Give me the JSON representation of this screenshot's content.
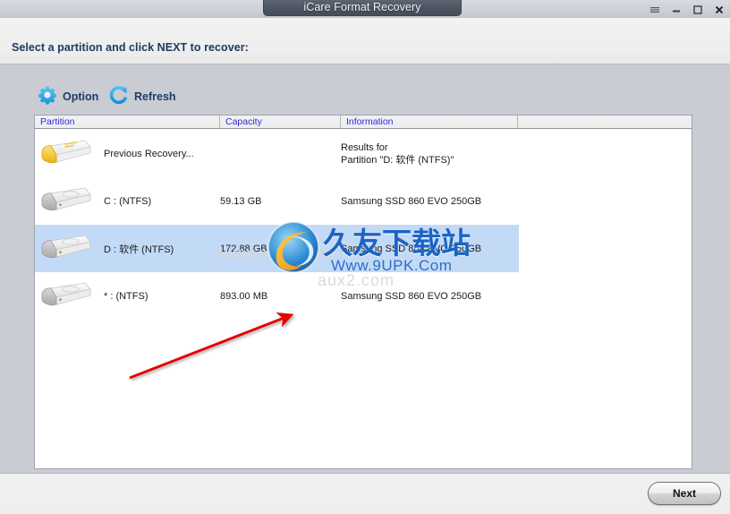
{
  "window": {
    "title": "iCare Format Recovery",
    "controls": [
      {
        "name": "menu-icon",
        "label": "≡"
      },
      {
        "name": "minimize-icon",
        "label": "–"
      },
      {
        "name": "maximize-icon",
        "label": "□"
      },
      {
        "name": "close-icon",
        "label": "×"
      }
    ]
  },
  "prompt": {
    "text": "Select a partition and click NEXT to recover:"
  },
  "toolbar": {
    "option_label": "Option",
    "option_icon": "gear-icon",
    "refresh_label": "Refresh",
    "refresh_icon": "refresh-icon",
    "icon_color": "#2ca6e8"
  },
  "table": {
    "headers": {
      "partition": "Partition",
      "capacity": "Capacity",
      "information": "Information",
      "blank": ""
    },
    "header_text_color": "#2b2be0",
    "selection_color": "#c3daf7",
    "rows": [
      {
        "icon": "disk-icon-yellow",
        "partition": "Previous Recovery...",
        "capacity": "",
        "info_line1": "Results for",
        "info_line2": "Partition \"D: 软件 (NTFS)\"",
        "selected": false
      },
      {
        "icon": "disk-icon-gray",
        "partition": "C :  (NTFS)",
        "capacity": "59.13 GB",
        "info_line1": "Samsung SSD 860 EVO 250GB",
        "info_line2": "",
        "selected": false
      },
      {
        "icon": "disk-icon-gray",
        "partition": "D : 软件  (NTFS)",
        "capacity": "172.88 GB",
        "info_line1": "Samsung SSD 860 EVO 250GB",
        "info_line2": "",
        "selected": true
      },
      {
        "icon": "disk-icon-gray",
        "partition": "* :  (NTFS)",
        "capacity": "893.00 MB",
        "info_line1": "Samsung SSD 860 EVO 250GB",
        "info_line2": "",
        "selected": false
      }
    ]
  },
  "watermark": {
    "cn_text": "久友下载站",
    "url_text": "Www.9UPK.Com",
    "faint_text": "WWW.9UPK.COM",
    "faint_text2": "aux2.com",
    "logo_icon": "circle-swoosh-logo-icon"
  },
  "annotation": {
    "arrow_color": "#e60000",
    "arrow_from": "145,422",
    "arrow_to": "327,351"
  },
  "footer": {
    "next_label": "Next"
  }
}
